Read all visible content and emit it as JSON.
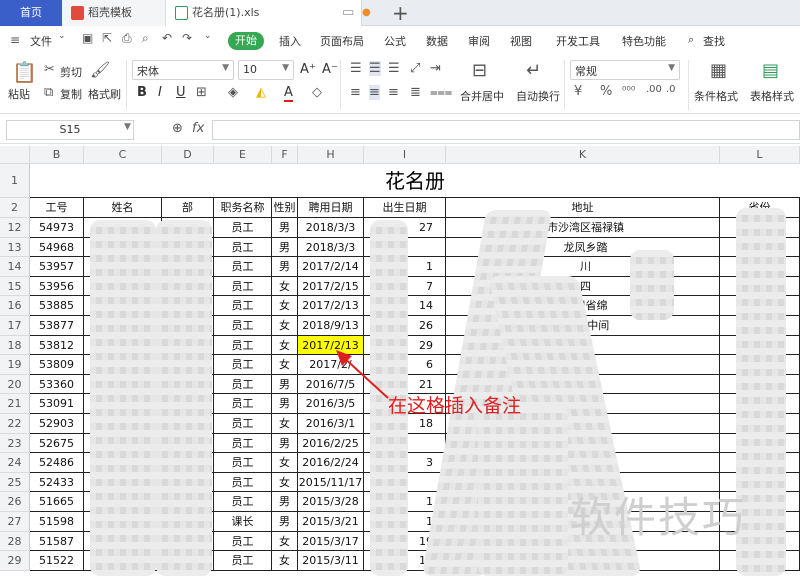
{
  "tabs": [
    {
      "label": "首页"
    },
    {
      "label": "稻壳模板"
    },
    {
      "label": "花名册(1).xls"
    }
  ],
  "menu": {
    "file": "文件",
    "start": "开始",
    "items": [
      "插入",
      "页面布局",
      "公式",
      "数据",
      "审阅",
      "视图",
      "开发工具",
      "特色功能"
    ],
    "search": "查找"
  },
  "ribbon": {
    "paste": "粘贴",
    "cut": "剪切",
    "copy": "复制",
    "format_painter": "格式刷",
    "font": "宋体",
    "size": "10",
    "merge": "合并居中",
    "wrap": "自动换行",
    "number_format": "常规",
    "cond_format": "条件格式",
    "table_style": "表格样式"
  },
  "formula": {
    "cell_ref": "S15",
    "fx": "fx"
  },
  "columns": [
    "B",
    "C",
    "D",
    "E",
    "F",
    "H",
    "I",
    "K",
    "L"
  ],
  "sheet_title": "花名册",
  "headers": [
    "工号",
    "姓名",
    "部",
    "职务名称",
    "性别",
    "聘用日期",
    "出生日期",
    "地址",
    "省份"
  ],
  "rows": [
    {
      "no": "12",
      "id": "54973",
      "title": "员工",
      "gender": "男",
      "hire": "2018/3/3",
      "birth": "27",
      "addr": "市沙湾区福禄镇"
    },
    {
      "no": "13",
      "id": "54968",
      "title": "员工",
      "gender": "男",
      "hire": "2018/3/3",
      "birth": "",
      "addr": "龙凤乡踏"
    },
    {
      "no": "14",
      "id": "53957",
      "title": "员工",
      "gender": "男",
      "hire": "2017/2/14",
      "birth": "1",
      "addr": "川"
    },
    {
      "no": "15",
      "id": "53956",
      "title": "员工",
      "gender": "女",
      "hire": "2017/2/15",
      "birth": "7",
      "addr": "四"
    },
    {
      "no": "16",
      "id": "53885",
      "title": "员工",
      "gender": "女",
      "hire": "2017/2/13",
      "birth": "14",
      "addr": "四川省绵"
    },
    {
      "no": "17",
      "id": "53877",
      "title": "员工",
      "gender": "女",
      "hire": "2018/9/13",
      "birth": "26",
      "addr": "云                                   田中间"
    },
    {
      "no": "18",
      "id": "53812",
      "title": "员工",
      "gender": "女",
      "hire": "2017/2/13",
      "birth": "29",
      "addr": ""
    },
    {
      "no": "19",
      "id": "53809",
      "title": "员工",
      "gender": "女",
      "hire": "2017/2/",
      "birth": "6",
      "addr": ""
    },
    {
      "no": "20",
      "id": "53360",
      "title": "员工",
      "gender": "男",
      "hire": "2016/7/5",
      "birth": "21",
      "addr": "门"
    },
    {
      "no": "21",
      "id": "53091",
      "title": "员工",
      "gender": "男",
      "hire": "2016/3/5",
      "birth": "",
      "addr": ""
    },
    {
      "no": "22",
      "id": "52903",
      "title": "员工",
      "gender": "女",
      "hire": "2016/3/1",
      "birth": "18",
      "addr": "四"
    },
    {
      "no": "23",
      "id": "52675",
      "title": "员工",
      "gender": "男",
      "hire": "2016/2/25",
      "birth": "",
      "addr": ""
    },
    {
      "no": "24",
      "id": "52486",
      "title": "员工",
      "gender": "女",
      "hire": "2016/2/24",
      "birth": "3",
      "addr": ""
    },
    {
      "no": "25",
      "id": "52433",
      "title": "员工",
      "gender": "女",
      "hire": "2015/11/17",
      "birth": "",
      "addr": "四"
    },
    {
      "no": "26",
      "id": "51665",
      "title": "员工",
      "gender": "男",
      "hire": "2015/3/28",
      "birth": "1",
      "addr": "四"
    },
    {
      "no": "27",
      "id": "51598",
      "title": "课长",
      "gender": "男",
      "hire": "2015/3/21",
      "birth": "1",
      "addr": ""
    },
    {
      "no": "28",
      "id": "51587",
      "title": "员工",
      "gender": "女",
      "hire": "2015/3/17",
      "birth": "19",
      "addr": ""
    },
    {
      "no": "29",
      "id": "51522",
      "title": "员工",
      "gender": "女",
      "hire": "2015/3/11",
      "birth": "19",
      "addr": ""
    }
  ],
  "annotation": "在这格插入备注",
  "watermark": "软件技巧",
  "colors": {
    "highlight": "#ffff00",
    "annotation": "#e02020",
    "start": "#35a853"
  }
}
